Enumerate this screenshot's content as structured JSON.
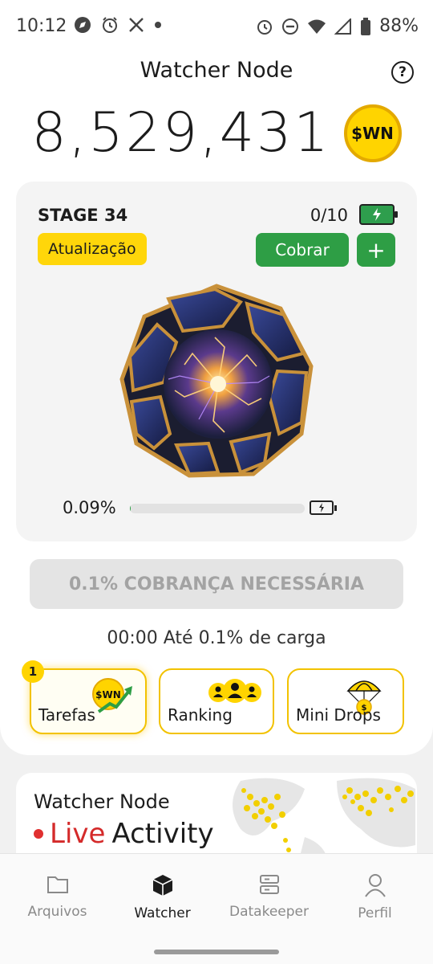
{
  "status_bar": {
    "time": "10:12",
    "battery": "88%",
    "left_icons": [
      "compass-icon",
      "alarm-icon",
      "x-logo-icon",
      "dot-icon"
    ],
    "right_icons": [
      "alarm-icon",
      "do-not-disturb-icon",
      "wifi-icon",
      "signal-icon",
      "battery-icon"
    ]
  },
  "header": {
    "title": "Watcher Node",
    "help": "?"
  },
  "balance": {
    "amount": "8,529,431",
    "token": "$WN"
  },
  "stage_card": {
    "stage": "STAGE 34",
    "count": "0/10",
    "update_label": "Atualização",
    "claim_label": "Cobrar",
    "plus_label": "+",
    "progress_text": "0.09%",
    "progress_value": 0.0009
  },
  "charge_button": "0.1% COBRANÇA NECESSÁRIA",
  "countdown": "00:00 Até 0.1% de carga",
  "tiles": [
    {
      "label": "Tarefas",
      "badge": "1",
      "icon": "swn-trend-icon"
    },
    {
      "label": "Ranking",
      "icon": "users-icon"
    },
    {
      "label": "Mini Drops",
      "icon": "parachute-coin-icon"
    }
  ],
  "live_card": {
    "title": "Watcher Node",
    "live": "Live",
    "activity": "Activity"
  },
  "nav": [
    {
      "label": "Arquivos",
      "icon": "folder-icon",
      "active": false
    },
    {
      "label": "Watcher",
      "icon": "cube-icon",
      "active": true
    },
    {
      "label": "Datakeeper",
      "icon": "server-icon",
      "active": false
    },
    {
      "label": "Perfil",
      "icon": "person-icon",
      "active": false
    }
  ],
  "colors": {
    "accent_yellow": "#ffd400",
    "accent_green": "#2e9e45",
    "live_red": "#d42a2a"
  }
}
